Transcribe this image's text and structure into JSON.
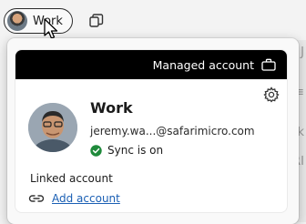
{
  "tabstrip": {
    "profile_button_label": "Work"
  },
  "flyout": {
    "managed_label": "Managed account",
    "profile": {
      "name": "Work",
      "email": "jeremy.wa...@safarimicro.com",
      "sync_status": "Sync is on"
    },
    "linked_account_label": "Linked account",
    "add_account_label": "Add account"
  },
  "colors": {
    "managed_bar": "#000000",
    "link": "#1a5fb4",
    "sync_check": "#1f8a3b"
  },
  "background_glyphs": [
    "J",
    "≡",
    "k",
    "RI"
  ]
}
